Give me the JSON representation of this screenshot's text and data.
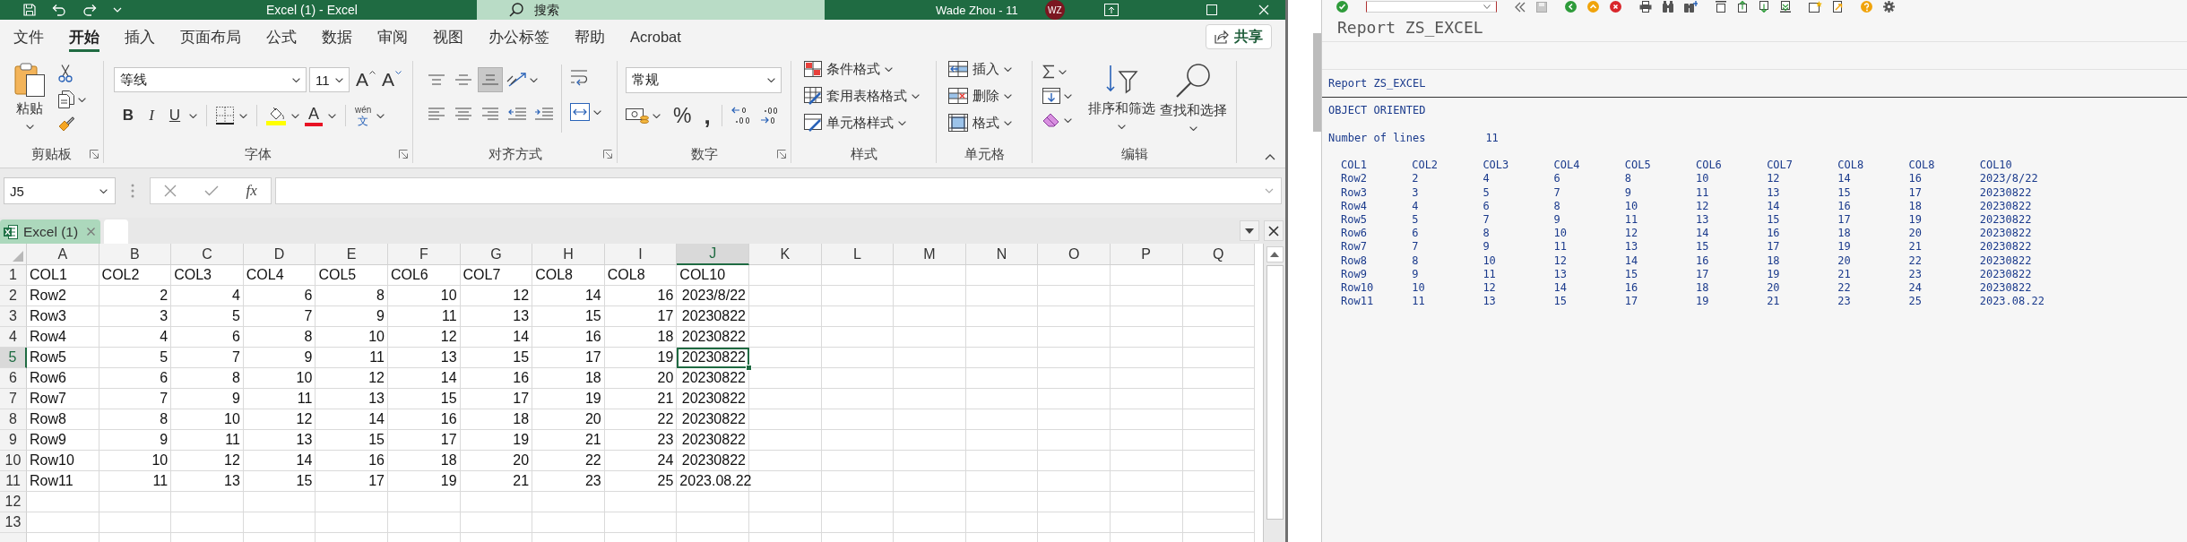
{
  "excel": {
    "title_bar": {
      "title": "Excel (1) - Excel",
      "search": {
        "placeholder": "搜索"
      },
      "account": "Wade Zhou - 11",
      "avatar": "WZ"
    },
    "ribbon_tabs": [
      {
        "label": "文件",
        "selected": false
      },
      {
        "label": "开始",
        "selected": true
      },
      {
        "label": "插入",
        "selected": false
      },
      {
        "label": "页面布局",
        "selected": false
      },
      {
        "label": "公式",
        "selected": false
      },
      {
        "label": "数据",
        "selected": false
      },
      {
        "label": "审阅",
        "selected": false
      },
      {
        "label": "视图",
        "selected": false
      },
      {
        "label": "办公标签",
        "selected": false
      },
      {
        "label": "帮助",
        "selected": false
      },
      {
        "label": "Acrobat",
        "selected": false
      }
    ],
    "share_button": "共享",
    "ribbon": {
      "clipboard": {
        "label": "剪贴板",
        "paste": "粘贴"
      },
      "font": {
        "label": "字体",
        "font_name": "等线",
        "font_size": "11",
        "grow": "A",
        "shrink": "A",
        "bold": "B",
        "italic": "I",
        "underline": "U",
        "font_color": "A",
        "phonetic": {
          "pinyin": "wén",
          "character": "文"
        }
      },
      "alignment": {
        "label": "对齐方式",
        "vertical": [
          {
            "kind": "top",
            "selected": false
          },
          {
            "kind": "middle",
            "selected": false
          },
          {
            "kind": "bottom",
            "selected": true
          }
        ],
        "horizontal": [
          {
            "kind": "left",
            "selected": false
          },
          {
            "kind": "center",
            "selected": false
          },
          {
            "kind": "right",
            "selected": false
          }
        ]
      },
      "number": {
        "label": "数字",
        "format": "常规",
        "percent": "%",
        "comma": ","
      },
      "styles": {
        "label": "样式",
        "items": [
          {
            "kind": "conditional",
            "label": "条件格式"
          },
          {
            "kind": "table",
            "label": "套用表格格式"
          },
          {
            "kind": "cell",
            "label": "单元格样式"
          }
        ]
      },
      "cells": {
        "label": "单元格",
        "items": [
          {
            "kind": "insert",
            "label": "插入"
          },
          {
            "kind": "delete",
            "label": "删除"
          },
          {
            "kind": "format",
            "label": "格式"
          }
        ]
      },
      "editing": {
        "label": "编辑",
        "sort": "排序和筛选",
        "find": "查找和选择"
      }
    },
    "formula_bar": {
      "name_box": "J5",
      "function_label": "fx"
    },
    "workbook_tabs": [
      {
        "label": "Excel (1)",
        "selected": true
      },
      {
        "selected": false
      }
    ],
    "sheet": {
      "columns": [
        {
          "label": "A",
          "selected": false
        },
        {
          "label": "B",
          "selected": false
        },
        {
          "label": "C",
          "selected": false
        },
        {
          "label": "D",
          "selected": false
        },
        {
          "label": "E",
          "selected": false
        },
        {
          "label": "F",
          "selected": false
        },
        {
          "label": "G",
          "selected": false
        },
        {
          "label": "H",
          "selected": false
        },
        {
          "label": "I",
          "selected": false
        },
        {
          "label": "J",
          "selected": true
        },
        {
          "label": "K",
          "selected": false
        },
        {
          "label": "L",
          "selected": false
        },
        {
          "label": "M",
          "selected": false
        },
        {
          "label": "N",
          "selected": false
        },
        {
          "label": "O",
          "selected": false
        },
        {
          "label": "P",
          "selected": false
        },
        {
          "label": "Q",
          "selected": false
        }
      ],
      "rows": [
        {
          "number": "1",
          "selected": false,
          "cells": [
            {
              "value": "COL1",
              "kind": "text"
            },
            {
              "value": "COL2",
              "kind": "text"
            },
            {
              "value": "COL3",
              "kind": "text"
            },
            {
              "value": "COL4",
              "kind": "text"
            },
            {
              "value": "COL5",
              "kind": "text"
            },
            {
              "value": "COL6",
              "kind": "text"
            },
            {
              "value": "COL7",
              "kind": "text"
            },
            {
              "value": "COL8",
              "kind": "text"
            },
            {
              "value": "COL8",
              "kind": "text"
            },
            {
              "value": "COL10",
              "kind": "text"
            }
          ]
        },
        {
          "number": "2",
          "selected": false,
          "cells": [
            {
              "value": "Row2",
              "kind": "text"
            },
            {
              "value": "2",
              "kind": "number"
            },
            {
              "value": "4",
              "kind": "number"
            },
            {
              "value": "6",
              "kind": "number"
            },
            {
              "value": "8",
              "kind": "number"
            },
            {
              "value": "10",
              "kind": "number"
            },
            {
              "value": "12",
              "kind": "number"
            },
            {
              "value": "14",
              "kind": "number"
            },
            {
              "value": "16",
              "kind": "number"
            },
            {
              "value": "2023/8/22",
              "kind": "date"
            }
          ]
        },
        {
          "number": "3",
          "selected": false,
          "cells": [
            {
              "value": "Row3",
              "kind": "text"
            },
            {
              "value": "3",
              "kind": "number"
            },
            {
              "value": "5",
              "kind": "number"
            },
            {
              "value": "7",
              "kind": "number"
            },
            {
              "value": "9",
              "kind": "number"
            },
            {
              "value": "11",
              "kind": "number"
            },
            {
              "value": "13",
              "kind": "number"
            },
            {
              "value": "15",
              "kind": "number"
            },
            {
              "value": "17",
              "kind": "number"
            },
            {
              "value": "20230822",
              "kind": "number"
            }
          ]
        },
        {
          "number": "4",
          "selected": false,
          "cells": [
            {
              "value": "Row4",
              "kind": "text"
            },
            {
              "value": "4",
              "kind": "number"
            },
            {
              "value": "6",
              "kind": "number"
            },
            {
              "value": "8",
              "kind": "number"
            },
            {
              "value": "10",
              "kind": "number"
            },
            {
              "value": "12",
              "kind": "number"
            },
            {
              "value": "14",
              "kind": "number"
            },
            {
              "value": "16",
              "kind": "number"
            },
            {
              "value": "18",
              "kind": "number"
            },
            {
              "value": "20230822",
              "kind": "number"
            }
          ]
        },
        {
          "number": "5",
          "selected": true,
          "cells": [
            {
              "value": "Row5",
              "kind": "text"
            },
            {
              "value": "5",
              "kind": "number"
            },
            {
              "value": "7",
              "kind": "number"
            },
            {
              "value": "9",
              "kind": "number"
            },
            {
              "value": "11",
              "kind": "number"
            },
            {
              "value": "13",
              "kind": "number"
            },
            {
              "value": "15",
              "kind": "number"
            },
            {
              "value": "17",
              "kind": "number"
            },
            {
              "value": "19",
              "kind": "number"
            },
            {
              "value": "20230822",
              "kind": "number"
            }
          ]
        },
        {
          "number": "6",
          "selected": false,
          "cells": [
            {
              "value": "Row6",
              "kind": "text"
            },
            {
              "value": "6",
              "kind": "number"
            },
            {
              "value": "8",
              "kind": "number"
            },
            {
              "value": "10",
              "kind": "number"
            },
            {
              "value": "12",
              "kind": "number"
            },
            {
              "value": "14",
              "kind": "number"
            },
            {
              "value": "16",
              "kind": "number"
            },
            {
              "value": "18",
              "kind": "number"
            },
            {
              "value": "20",
              "kind": "number"
            },
            {
              "value": "20230822",
              "kind": "number"
            }
          ]
        },
        {
          "number": "7",
          "selected": false,
          "cells": [
            {
              "value": "Row7",
              "kind": "text"
            },
            {
              "value": "7",
              "kind": "number"
            },
            {
              "value": "9",
              "kind": "number"
            },
            {
              "value": "11",
              "kind": "number"
            },
            {
              "value": "13",
              "kind": "number"
            },
            {
              "value": "15",
              "kind": "number"
            },
            {
              "value": "17",
              "kind": "number"
            },
            {
              "value": "19",
              "kind": "number"
            },
            {
              "value": "21",
              "kind": "number"
            },
            {
              "value": "20230822",
              "kind": "number"
            }
          ]
        },
        {
          "number": "8",
          "selected": false,
          "cells": [
            {
              "value": "Row8",
              "kind": "text"
            },
            {
              "value": "8",
              "kind": "number"
            },
            {
              "value": "10",
              "kind": "number"
            },
            {
              "value": "12",
              "kind": "number"
            },
            {
              "value": "14",
              "kind": "number"
            },
            {
              "value": "16",
              "kind": "number"
            },
            {
              "value": "18",
              "kind": "number"
            },
            {
              "value": "20",
              "kind": "number"
            },
            {
              "value": "22",
              "kind": "number"
            },
            {
              "value": "20230822",
              "kind": "number"
            }
          ]
        },
        {
          "number": "9",
          "selected": false,
          "cells": [
            {
              "value": "Row9",
              "kind": "text"
            },
            {
              "value": "9",
              "kind": "number"
            },
            {
              "value": "11",
              "kind": "number"
            },
            {
              "value": "13",
              "kind": "number"
            },
            {
              "value": "15",
              "kind": "number"
            },
            {
              "value": "17",
              "kind": "number"
            },
            {
              "value": "19",
              "kind": "number"
            },
            {
              "value": "21",
              "kind": "number"
            },
            {
              "value": "23",
              "kind": "number"
            },
            {
              "value": "20230822",
              "kind": "number"
            }
          ]
        },
        {
          "number": "10",
          "selected": false,
          "cells": [
            {
              "value": "Row10",
              "kind": "text"
            },
            {
              "value": "10",
              "kind": "number"
            },
            {
              "value": "12",
              "kind": "number"
            },
            {
              "value": "14",
              "kind": "number"
            },
            {
              "value": "16",
              "kind": "number"
            },
            {
              "value": "18",
              "kind": "number"
            },
            {
              "value": "20",
              "kind": "number"
            },
            {
              "value": "22",
              "kind": "number"
            },
            {
              "value": "24",
              "kind": "number"
            },
            {
              "value": "20230822",
              "kind": "number"
            }
          ]
        },
        {
          "number": "11",
          "selected": false,
          "cells": [
            {
              "value": "Row11",
              "kind": "text"
            },
            {
              "value": "11",
              "kind": "number"
            },
            {
              "value": "13",
              "kind": "number"
            },
            {
              "value": "15",
              "kind": "number"
            },
            {
              "value": "17",
              "kind": "number"
            },
            {
              "value": "19",
              "kind": "number"
            },
            {
              "value": "21",
              "kind": "number"
            },
            {
              "value": "23",
              "kind": "number"
            },
            {
              "value": "25",
              "kind": "number"
            },
            {
              "value": "2023.08.22",
              "kind": "text"
            }
          ]
        },
        {
          "number": "12",
          "selected": false
        },
        {
          "number": "13",
          "selected": false
        }
      ]
    }
  },
  "sap": {
    "window_title": "Report ZS_EXCEL",
    "report": {
      "heading": "Report ZS_EXCEL",
      "subheading": "OBJECT ORIENTED",
      "line_count_label": "Number of lines",
      "line_count": "11",
      "table": {
        "columns": [
          "COL1",
          "COL2",
          "COL3",
          "COL4",
          "COL5",
          "COL6",
          "COL7",
          "COL8",
          "COL8",
          "COL10"
        ],
        "rows": [
          [
            "Row2",
            "2",
            "4",
            "6",
            "8",
            "10",
            "12",
            "14",
            "16",
            "2023/8/22"
          ],
          [
            "Row3",
            "3",
            "5",
            "7",
            "9",
            "11",
            "13",
            "15",
            "17",
            "20230822"
          ],
          [
            "Row4",
            "4",
            "6",
            "8",
            "10",
            "12",
            "14",
            "16",
            "18",
            "20230822"
          ],
          [
            "Row5",
            "5",
            "7",
            "9",
            "11",
            "13",
            "15",
            "17",
            "19",
            "20230822"
          ],
          [
            "Row6",
            "6",
            "8",
            "10",
            "12",
            "14",
            "16",
            "18",
            "20",
            "20230822"
          ],
          [
            "Row7",
            "7",
            "9",
            "11",
            "13",
            "15",
            "17",
            "19",
            "21",
            "20230822"
          ],
          [
            "Row8",
            "8",
            "10",
            "12",
            "14",
            "16",
            "18",
            "20",
            "22",
            "20230822"
          ],
          [
            "Row9",
            "9",
            "11",
            "13",
            "15",
            "17",
            "19",
            "21",
            "23",
            "20230822"
          ],
          [
            "Row10",
            "10",
            "12",
            "14",
            "16",
            "18",
            "20",
            "22",
            "24",
            "20230822"
          ],
          [
            "Row11",
            "11",
            "13",
            "15",
            "17",
            "19",
            "21",
            "23",
            "25",
            "2023.08.22"
          ]
        ]
      }
    }
  }
}
